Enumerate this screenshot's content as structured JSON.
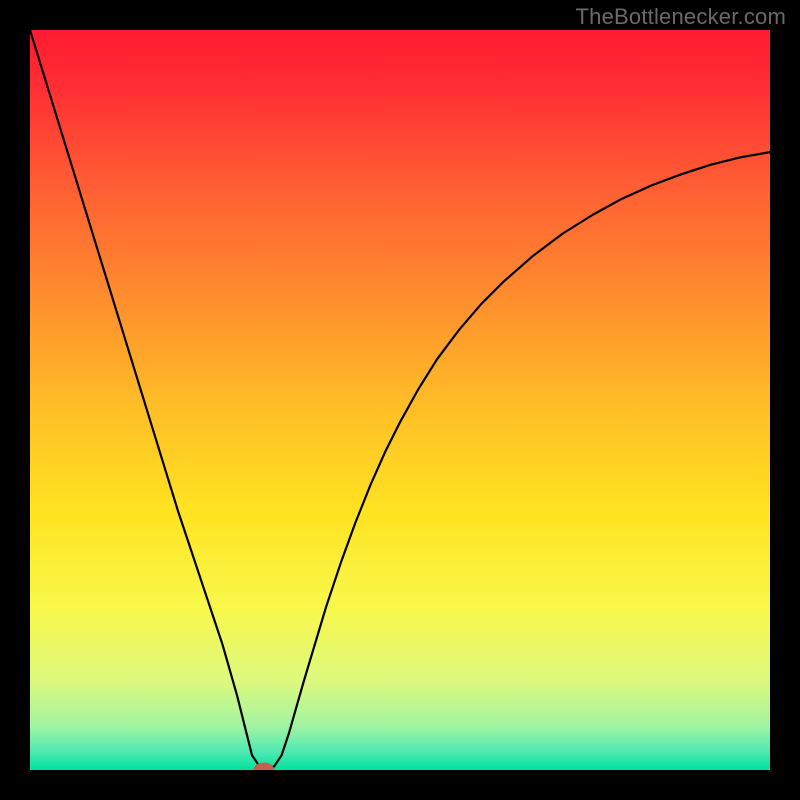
{
  "watermark": "TheBottlenecker.com",
  "chart_data": {
    "type": "line",
    "title": "",
    "xlabel": "",
    "ylabel": "",
    "xlim": [
      0,
      100
    ],
    "ylim": [
      0,
      100
    ],
    "background": {
      "type": "vertical-gradient",
      "stops": [
        {
          "pos": 0.0,
          "color": "#ff1b30"
        },
        {
          "pos": 0.08,
          "color": "#ff2f34"
        },
        {
          "pos": 0.2,
          "color": "#ff5a34"
        },
        {
          "pos": 0.35,
          "color": "#ff8a2e"
        },
        {
          "pos": 0.5,
          "color": "#ffbb27"
        },
        {
          "pos": 0.65,
          "color": "#ffe321"
        },
        {
          "pos": 0.78,
          "color": "#f8f84b"
        },
        {
          "pos": 0.88,
          "color": "#dcf97e"
        },
        {
          "pos": 0.94,
          "color": "#a3f4a1"
        },
        {
          "pos": 0.975,
          "color": "#4fe9b2"
        },
        {
          "pos": 1.0,
          "color": "#00e19e"
        }
      ]
    },
    "series": [
      {
        "name": "bottleneck-curve",
        "color": "#000000",
        "x": [
          0.0,
          2.0,
          4.0,
          6.0,
          8.0,
          10.0,
          12.0,
          14.0,
          16.0,
          18.0,
          20.0,
          22.0,
          24.0,
          25.0,
          26.0,
          27.0,
          28.0,
          29.0,
          29.5,
          30.0,
          31.0,
          31.6,
          32.0,
          33.0,
          34.0,
          35.0,
          36.0,
          37.0,
          38.5,
          40.0,
          42.0,
          44.0,
          46.0,
          48.0,
          50.0,
          52.5,
          55.0,
          58.0,
          61.0,
          64.0,
          68.0,
          72.0,
          76.0,
          80.0,
          84.0,
          88.0,
          92.0,
          96.0,
          100.0
        ],
        "y": [
          100.0,
          93.5,
          87.0,
          80.5,
          74.0,
          67.5,
          61.0,
          54.5,
          48.0,
          41.5,
          35.0,
          29.0,
          23.0,
          20.0,
          17.0,
          13.5,
          10.0,
          6.0,
          4.0,
          2.0,
          0.5,
          0.0,
          0.0,
          0.5,
          2.0,
          5.0,
          8.5,
          12.0,
          17.0,
          22.0,
          28.0,
          33.5,
          38.5,
          43.0,
          47.0,
          51.5,
          55.5,
          59.5,
          63.0,
          66.0,
          69.5,
          72.5,
          75.0,
          77.2,
          79.0,
          80.5,
          81.8,
          82.8,
          83.5
        ]
      }
    ],
    "marker": {
      "name": "optimal-point",
      "x": 31.6,
      "y": 0.0,
      "color": "#cf5a4f",
      "rx": 1.4,
      "ry": 1.0
    }
  }
}
